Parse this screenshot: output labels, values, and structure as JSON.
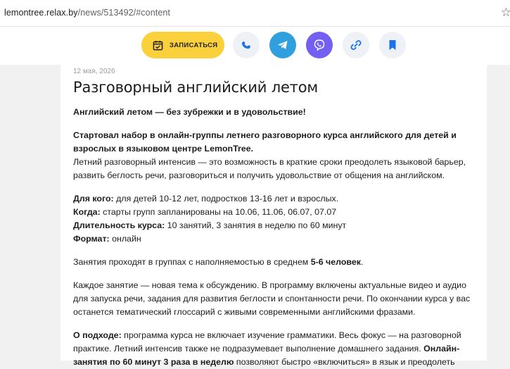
{
  "browser": {
    "url_host": "lemontree.relax.by",
    "url_path": "/news/513492/#content"
  },
  "toolbar": {
    "signup_label": "ЗАПИСАТЬСЯ",
    "icons": [
      "calendar-icon",
      "phone-icon",
      "telegram-icon",
      "viber-icon",
      "link-icon",
      "bookmark-icon"
    ],
    "colors": {
      "signup": "#fad13c",
      "telegram": "#2fa0dd",
      "viber": "#7360f2",
      "icon_blue": "#1a73e8"
    }
  },
  "article": {
    "date": "12 мая, 2026",
    "title": "Разговорный английский летом",
    "lead": "Английский летом — без зубрежки и в удовольствие!",
    "intro_bold": "Стартовал набор в онлайн-группы летнего разговорного курса английского для детей и взрослых в языковом центре LemonTree.",
    "intro_text": "Летний разговорный интенсив — это возможность в краткие сроки преодолеть языковой барьер, развить беглость речи, разговориться и получить удовольствие от общения на английском.",
    "facts": [
      {
        "label": "Для кого:",
        "value": " для детей 10-12 лет, подростков 13-16 лет и взрослых."
      },
      {
        "label": "Когда:",
        "value": " старты групп запланированы на 10.06, 11.06, 06.07, 07.07"
      },
      {
        "label": "Длительность курса:",
        "value": " 10 занятий, 3 занятия в неделю по 60 минут"
      },
      {
        "label": "Формат:",
        "value": " онлайн"
      }
    ],
    "groups_text": "Занятия проходят в группах с наполняемостью в среднем ",
    "groups_bold": "5-6 человек",
    "groups_end": ".",
    "lesson_text": "Каждое занятие — новая тема к обсуждению. В программу включены актуальные видео и аудио для запуска речи, задания для развития беглости и спонтанности речи. По окончании курса у вас останется тематический глоссарий с живыми современными английскими фразами.",
    "approach_label": "О подходе:",
    "approach_text": " программа курса не включает изучение грамматики. Весь фокус — на разговорной практике. Летний интенсив также не подразумевает выполнение домашнего задания. ",
    "approach_bold": "Онлайн-занятия по 60 минут 3 раза в неделю",
    "approach_end": " позволяют быстро «включиться» в язык и преодолеть"
  }
}
